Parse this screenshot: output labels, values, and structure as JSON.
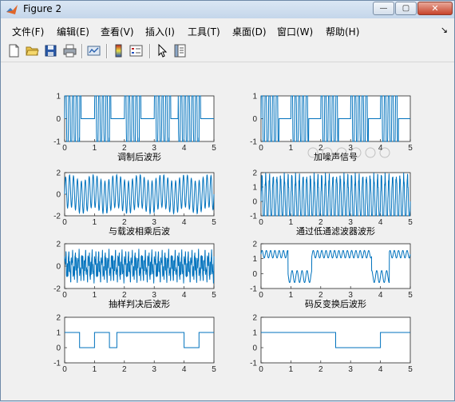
{
  "window": {
    "title": "Figure 2",
    "min_symbol": "—",
    "max_symbol": "▢",
    "close_symbol": "✕"
  },
  "menu": [
    {
      "label": "文件(F)"
    },
    {
      "label": "编辑(E)"
    },
    {
      "label": "查看(V)"
    },
    {
      "label": "插入(I)"
    },
    {
      "label": "工具(T)"
    },
    {
      "label": "桌面(D)"
    },
    {
      "label": "窗口(W)"
    },
    {
      "label": "帮助(H)"
    }
  ],
  "menu_overflow": "↘",
  "toolbar": [
    "new-figure-icon",
    "open-folder-icon",
    "save-icon",
    "print-icon",
    "link-icon",
    "colorbar-icon",
    "legend-icon",
    "pointer-icon",
    "property-editor-icon"
  ],
  "watermark": "加噪声信号",
  "chart_data": [
    {
      "type": "line",
      "title": "调制后波形",
      "xlim": [
        0,
        5
      ],
      "ylim": [
        -1,
        1
      ],
      "yticks": [
        -1,
        0,
        1
      ],
      "xticks": [
        0,
        1,
        2,
        3,
        4,
        5
      ]
    },
    {
      "type": "line",
      "title": "加噪声信号",
      "xlim": [
        0,
        5
      ],
      "ylim": [
        -1,
        1
      ],
      "yticks": [
        -1,
        0,
        1
      ],
      "xticks": [
        0,
        1,
        2,
        3,
        4,
        5
      ]
    },
    {
      "type": "line",
      "title": "与载波相乘后波",
      "xlim": [
        0,
        5
      ],
      "ylim": [
        -2,
        2
      ],
      "yticks": [
        -2,
        0,
        2
      ],
      "xticks": [
        0,
        1,
        2,
        3,
        4,
        5
      ]
    },
    {
      "type": "line",
      "title": "通过低通滤波器波形",
      "xlim": [
        0,
        5
      ],
      "ylim": [
        -1,
        2
      ],
      "yticks": [
        -1,
        0,
        1,
        2
      ],
      "xticks": [
        0,
        1,
        2,
        3,
        4,
        5
      ]
    },
    {
      "type": "line",
      "title": "抽样判决后波形",
      "xlim": [
        0,
        5
      ],
      "ylim": [
        -2,
        2
      ],
      "yticks": [
        -2,
        0,
        2
      ],
      "xticks": [
        0,
        1,
        2,
        3,
        4,
        5
      ]
    },
    {
      "type": "line",
      "title": "码反变换后波形",
      "xlim": [
        0,
        5
      ],
      "ylim": [
        -1,
        2
      ],
      "yticks": [
        -1,
        0,
        1,
        2
      ],
      "xticks": [
        0,
        1,
        2,
        3,
        4,
        5
      ]
    },
    {
      "type": "line",
      "title": "",
      "xlim": [
        0,
        5
      ],
      "ylim": [
        -1,
        2
      ],
      "yticks": [
        -1,
        0,
        1,
        2
      ],
      "xticks": [
        0,
        1,
        2,
        3,
        4,
        5
      ],
      "x": [
        0,
        0.5,
        0.5,
        1,
        1,
        1.5,
        1.5,
        1.75,
        1.75,
        4,
        4,
        4.5,
        4.5,
        5
      ],
      "y": [
        1,
        1,
        0,
        0,
        1,
        1,
        0,
        0,
        1,
        1,
        0,
        0,
        1,
        1
      ]
    },
    {
      "type": "line",
      "title": "",
      "xlim": [
        0,
        5
      ],
      "ylim": [
        -1,
        2
      ],
      "yticks": [
        -1,
        0,
        1,
        2
      ],
      "xticks": [
        0,
        1,
        2,
        3,
        4,
        5
      ],
      "x": [
        0,
        2.5,
        2.5,
        4,
        4,
        5
      ],
      "y": [
        1,
        1,
        0,
        0,
        1,
        1
      ]
    }
  ]
}
